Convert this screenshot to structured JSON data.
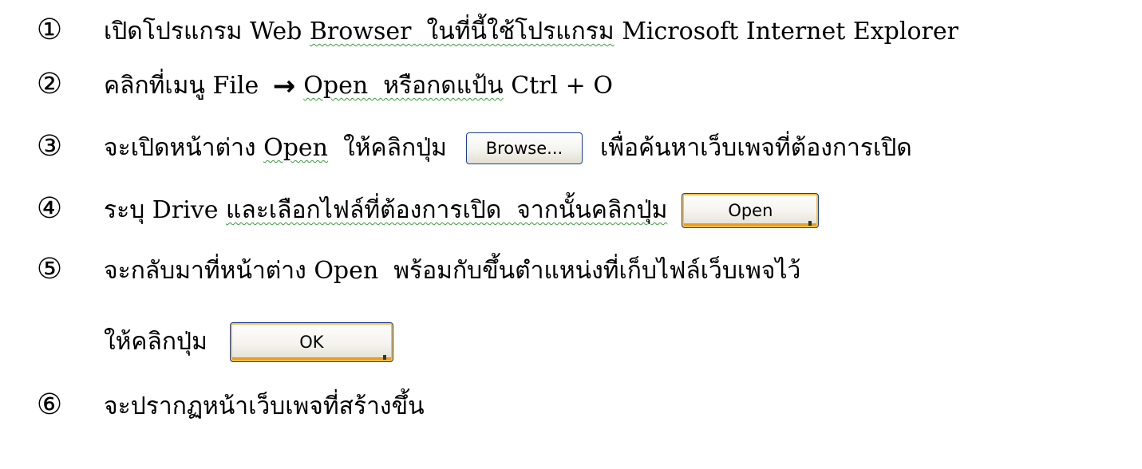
{
  "steps": [
    {
      "num": "①",
      "parts": [
        {
          "t": "เปิดโปรแกรม Web ",
          "s": false
        },
        {
          "t": "Browser  ในที่นี้ใช้โปรแกรม",
          "s": true
        },
        {
          "t": " Microsoft Internet Explorer",
          "s": false
        }
      ]
    },
    {
      "num": "②",
      "parts": [
        {
          "t": "คลิกที่เมนู File ",
          "s": false
        },
        {
          "arrow": "→"
        },
        {
          "t": "Open  หรือกดแป้น",
          "s": true
        },
        {
          "t": " Ctrl + O",
          "s": false
        }
      ]
    },
    {
      "num": "③",
      "parts": [
        {
          "t": "จะเปิดหน้าต่าง ",
          "s": false
        },
        {
          "t": "Open",
          "s": true
        },
        {
          "t": "  ให้คลิกปุ่ม",
          "s": false
        },
        {
          "btn": "Browse...",
          "cls": "btn-browse",
          "name": "browse-button"
        },
        {
          "t": "เพื่อค้นหาเว็บเพจที่ต้องการเปิด",
          "s": false
        }
      ]
    },
    {
      "num": "④",
      "parts": [
        {
          "t": "ระบุ Drive ",
          "s": false
        },
        {
          "t": "และเลือกไฟล์ที่ต้องการเปิด  จากนั้นคลิกปุ่ม",
          "s": true
        },
        {
          "btn": "Open",
          "cls": "btn-open",
          "name": "open-button"
        }
      ]
    },
    {
      "num": "⑤",
      "parts": [
        {
          "t": "จะกลับมาที่หน้าต่าง Open  พร้อมกับขึ้นตำแหน่งที่เก็บไฟล์เว็บเพจไว้",
          "s": false
        }
      ]
    },
    {
      "num": "",
      "parts": [
        {
          "t": "ให้คลิกปุ่ม",
          "s": false
        },
        {
          "btn": "OK",
          "cls": "btn-ok",
          "name": "ok-button"
        }
      ]
    },
    {
      "num": "⑥",
      "parts": [
        {
          "t": "จะปรากฏหน้าเว็บเพจที่สร้างขึ้น",
          "s": false
        }
      ]
    }
  ]
}
